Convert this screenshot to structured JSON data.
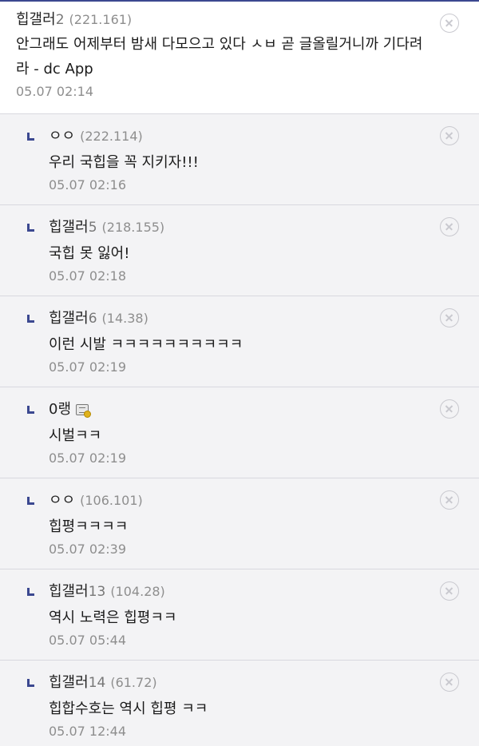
{
  "comments": [
    {
      "nick": "힙갤러",
      "gallnum": "2",
      "ip": "(221.161)",
      "text": "안그래도 어제부터 밤새 다모으고 있다 ㅅㅂ 곧 글올릴거니까 기다려라 - dc App",
      "date": "05.07 02:14"
    }
  ],
  "replies": [
    {
      "nick": "ㅇㅇ",
      "gallnum": "",
      "ip": "(222.114)",
      "text": "우리 국힙을 꼭 지키자!!!",
      "date": "05.07 02:16"
    },
    {
      "nick": "힙갤러",
      "gallnum": "5",
      "ip": "(218.155)",
      "text": "국힙 못 잃어!",
      "date": "05.07 02:18"
    },
    {
      "nick": "힙갤러",
      "gallnum": "6",
      "ip": "(14.38)",
      "text": "이런 시발 ㅋㅋㅋㅋㅋㅋㅋㅋㅋㅋ",
      "date": "05.07 02:19"
    },
    {
      "nick": "0랭",
      "gallnum": "",
      "ip": "",
      "icon": "fixed-nick-icon",
      "text": "시벌ㅋㅋ",
      "date": "05.07 02:19"
    },
    {
      "nick": "ㅇㅇ",
      "gallnum": "",
      "ip": "(106.101)",
      "text": "힙평ㅋㅋㅋㅋ",
      "date": "05.07 02:39"
    },
    {
      "nick": "힙갤러",
      "gallnum": "13",
      "ip": "(104.28)",
      "text": "역시 노력은 힙평ㅋㅋ",
      "date": "05.07 05:44"
    },
    {
      "nick": "힙갤러",
      "gallnum": "14",
      "ip": "(61.72)",
      "text": "힙합수호는 역시 힙평 ㅋㅋ",
      "date": "05.07 12:44"
    }
  ],
  "colors": {
    "accent": "#3b4890",
    "reply_bg": "#f3f3f5",
    "meta_text": "#8e8e8e"
  },
  "icons": {
    "delete": "close-circle-icon",
    "reply": "reply-arrow-icon"
  }
}
